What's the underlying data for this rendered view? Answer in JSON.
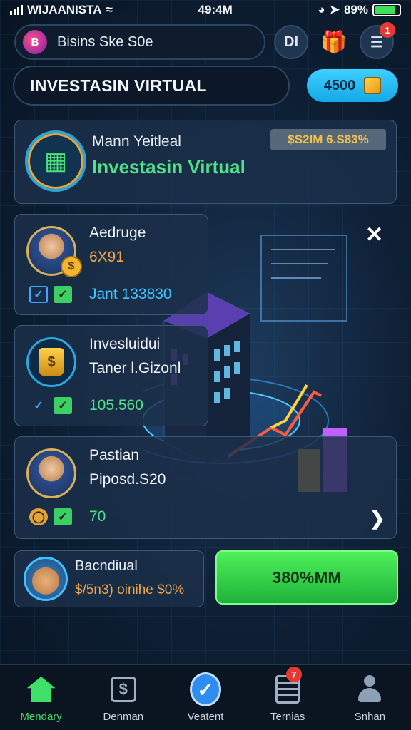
{
  "status_bar": {
    "carrier": "WIJAANISTA",
    "time": "49:4M",
    "battery": "89%"
  },
  "header": {
    "logo_label": "B",
    "search_text": "Bisins Ske S0e",
    "menu_label": "DI",
    "notification_count": "1"
  },
  "title_bar": {
    "title": "INVESTASIN VIRTUAL",
    "coins": "4500"
  },
  "hero": {
    "subtitle": "Mann Yeitleal",
    "title": "Investasin Virtual",
    "stat": "$S2IM 6.S83%"
  },
  "cards": [
    {
      "name": "Aedruge",
      "value": "6X91",
      "foot": "Jant 133830",
      "coin": "$"
    },
    {
      "name": "Invesluidui",
      "line2": "Taner l.Gizonl",
      "foot": "105.560",
      "bag": "$"
    },
    {
      "name": "Pastian",
      "line2": "Piposd.S20",
      "foot": "70"
    }
  ],
  "profile": {
    "name": "Bacndiual",
    "sub": "$/5n3) oinihe $0%"
  },
  "cta": {
    "label": "380%MM"
  },
  "tabs": [
    {
      "label": "Mendary"
    },
    {
      "label": "Denman"
    },
    {
      "label": "Veatent"
    },
    {
      "label": "Ternias",
      "badge": "7"
    },
    {
      "label": "Snhan"
    }
  ],
  "colors": {
    "accent_green": "#3fe06a",
    "accent_blue": "#2f8cf0",
    "accent_orange": "#f0a646"
  }
}
